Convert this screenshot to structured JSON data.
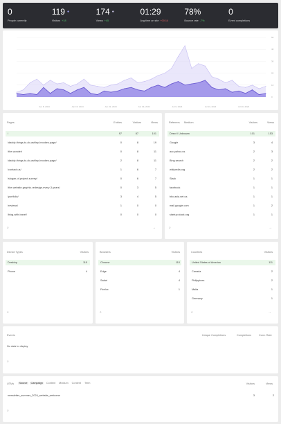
{
  "kpis": [
    {
      "value": "0",
      "label": "People currently",
      "delta": "",
      "dir": ""
    },
    {
      "value": "119",
      "label": "Visitors",
      "delta": "+18",
      "dir": "up",
      "dot": true
    },
    {
      "value": "174",
      "label": "Views",
      "delta": "+45",
      "dir": "up",
      "dot": true
    },
    {
      "value": "01:29",
      "label": "Avg time on site",
      "delta": "+00:14",
      "dir": "down"
    },
    {
      "value": "78%",
      "label": "Bounce rate",
      "delta": "-7%",
      "dir": "up"
    },
    {
      "value": "0",
      "label": "Event completions",
      "delta": "",
      "dir": ""
    }
  ],
  "chart_data": {
    "type": "area",
    "x_labels": [
      "Jun 8, 2024",
      "Jun 15, 2024",
      "Jun 22, 2024",
      "Jun 29, 2024",
      "Jul 6, 2024",
      "Jul 13, 2024",
      "Jul 20, 2024"
    ],
    "y_ticks": [
      "50",
      "40",
      "30",
      "20",
      "10",
      "0"
    ],
    "ylim": [
      0,
      50
    ],
    "series": [
      {
        "name": "Views",
        "color": "#d9d4f7",
        "values": [
          4,
          6,
          12,
          15,
          10,
          14,
          11,
          12,
          9,
          11,
          15,
          10,
          9,
          8,
          10,
          11,
          14,
          16,
          12,
          13,
          15,
          18,
          20,
          24,
          34,
          43,
          24,
          28,
          26,
          17,
          15,
          12,
          14,
          9,
          8,
          10,
          7,
          9
        ]
      },
      {
        "name": "Visitors",
        "color": "#8e80e6",
        "values": [
          3,
          2,
          3,
          2,
          8,
          3,
          7,
          6,
          3,
          6,
          8,
          3,
          2,
          5,
          4,
          5,
          7,
          8,
          6,
          5,
          8,
          10,
          8,
          11,
          13,
          10,
          11,
          12,
          14,
          8,
          6,
          7,
          4,
          5,
          3,
          6,
          2,
          3
        ]
      }
    ]
  },
  "pages": {
    "title": "Pages",
    "cols": [
      "Entries",
      "Visitors",
      "Views"
    ],
    "rows": [
      {
        "name": "/",
        "entries": "97",
        "visitors": "87",
        "views": "101"
      },
      {
        "name": "/daddy-things-to-do-ashley-brookes-page/",
        "entries": "0",
        "visitors": "8",
        "views": "19"
      },
      {
        "name": "/the-wonder/",
        "entries": "0",
        "visitors": "8",
        "views": "11"
      },
      {
        "name": "/daddy-things-to-do-ashley-brookes-page/",
        "entries": "2",
        "visitors": "8",
        "views": "11"
      },
      {
        "name": "/contact-us/",
        "entries": "1",
        "visitors": "6",
        "views": "7"
      },
      {
        "name": "/slogan-of-project-survey/",
        "entries": "0",
        "visitors": "6",
        "views": "7"
      },
      {
        "name": "/the-website-graphic-redesign-every-3-years/",
        "entries": "0",
        "visitors": "3",
        "views": "5"
      },
      {
        "name": "/portfolio/",
        "entries": "3",
        "visitors": "4",
        "views": "5"
      },
      {
        "name": "/reviews/",
        "entries": "1",
        "visitors": "0",
        "views": "0"
      },
      {
        "name": "/blog-with-travel/",
        "entries": "0",
        "visitors": "0",
        "views": "0"
      }
    ]
  },
  "referrers": {
    "title": "Referrers",
    "tab": "Medium",
    "cols": [
      "Visitors",
      "Views"
    ],
    "rows": [
      {
        "name": "Direct / Unknown",
        "visitors": "101",
        "views": "153"
      },
      {
        "name": "Google",
        "visitors": "3",
        "views": "4"
      },
      {
        "name": "acc.yahoo.us",
        "visitors": "2",
        "views": "3"
      },
      {
        "name": "Bing search",
        "visitors": "2",
        "views": "2"
      },
      {
        "name": "wikipedia.org",
        "visitors": "2",
        "views": "2"
      },
      {
        "name": "Slack",
        "visitors": "1",
        "views": "1"
      },
      {
        "name": "facebook",
        "visitors": "1",
        "views": "1"
      },
      {
        "name": "bbc.asia.net.us",
        "visitors": "1",
        "views": "1"
      },
      {
        "name": "mail.google.com",
        "visitors": "1",
        "views": "2"
      },
      {
        "name": "startup.stack.org",
        "visitors": "1",
        "views": "1"
      }
    ]
  },
  "devices": {
    "title": "Device Types",
    "col": "Visitors",
    "rows": [
      {
        "name": "Desktop",
        "value": "115"
      },
      {
        "name": "Phone",
        "value": "4"
      }
    ]
  },
  "browsers": {
    "title": "Browsers",
    "col": "Visitors",
    "rows": [
      {
        "name": "Chrome",
        "value": "110"
      },
      {
        "name": "Edge",
        "value": "4"
      },
      {
        "name": "Safari",
        "value": "4"
      },
      {
        "name": "Firefox",
        "value": "1"
      }
    ]
  },
  "countries": {
    "title": "Countries",
    "col": "Visitors",
    "rows": [
      {
        "name": "United States of America",
        "value": "111"
      },
      {
        "name": "Canada",
        "value": "2"
      },
      {
        "name": "Philippines",
        "value": "2"
      },
      {
        "name": "Malta",
        "value": "1"
      },
      {
        "name": "Germany",
        "value": "1"
      }
    ]
  },
  "events": {
    "title": "Events",
    "cols": [
      "Unique Completions",
      "Completions",
      "Conv. Rate"
    ],
    "empty": "No data to display"
  },
  "utms": {
    "title": "UTMs",
    "tabs": [
      "Source",
      "Campaign",
      "Content",
      "Medium",
      "Content",
      "Term"
    ],
    "cols": [
      "Visitors",
      "Views"
    ],
    "rows": [
      {
        "name": "newsletter_summer_2024_website_welcome",
        "visitors": "3",
        "views": "2"
      }
    ]
  },
  "icons": {
    "search": "search-icon",
    "arrow": "arrow-right-icon"
  }
}
